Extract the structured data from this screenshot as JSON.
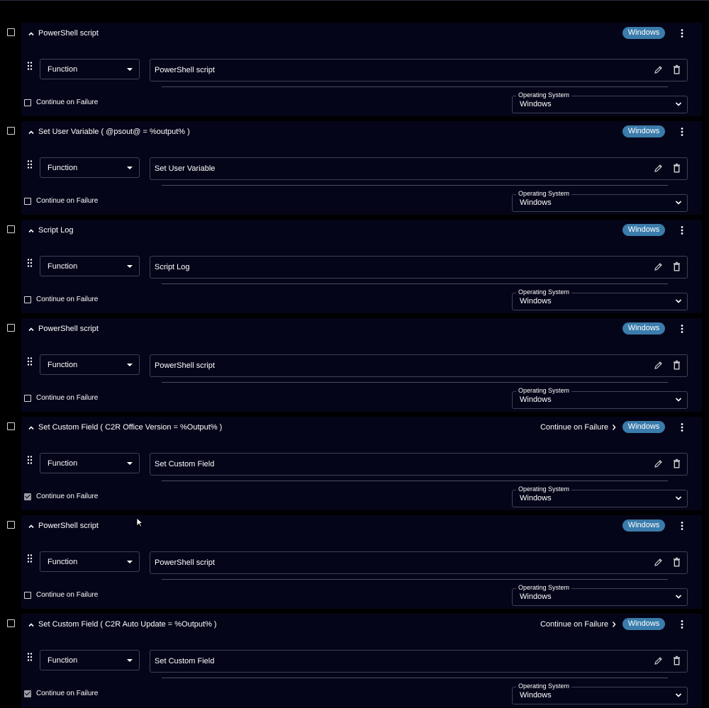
{
  "labels": {
    "function": "Function",
    "continue_on_failure": "Continue on Failure",
    "operating_system_legend": "Operating System",
    "os_value": "Windows",
    "os_badge": "Windows"
  },
  "colors": {
    "background": "#000000",
    "card": "#050519",
    "badge": "#3a7cab",
    "border": "#3d4255"
  },
  "steps": [
    {
      "title": "PowerShell script",
      "field_value": "PowerShell script",
      "continue_on_failure_checked": false,
      "header_continue_label": ""
    },
    {
      "title": "Set User Variable ( @psout@ = %output% )",
      "field_value": "Set User Variable",
      "continue_on_failure_checked": false,
      "header_continue_label": ""
    },
    {
      "title": "Script Log",
      "field_value": "Script Log",
      "continue_on_failure_checked": false,
      "header_continue_label": ""
    },
    {
      "title": "PowerShell script",
      "field_value": "PowerShell script",
      "continue_on_failure_checked": false,
      "header_continue_label": ""
    },
    {
      "title": "Set Custom Field ( C2R Office Version = %Output% )",
      "field_value": "Set Custom Field",
      "continue_on_failure_checked": true,
      "header_continue_label": "Continue on Failure"
    },
    {
      "title": "PowerShell script",
      "field_value": "PowerShell script",
      "continue_on_failure_checked": false,
      "header_continue_label": ""
    },
    {
      "title": "Set Custom Field ( C2R Auto Update = %Output% )",
      "field_value": "Set Custom Field",
      "continue_on_failure_checked": true,
      "header_continue_label": "Continue on Failure"
    }
  ]
}
